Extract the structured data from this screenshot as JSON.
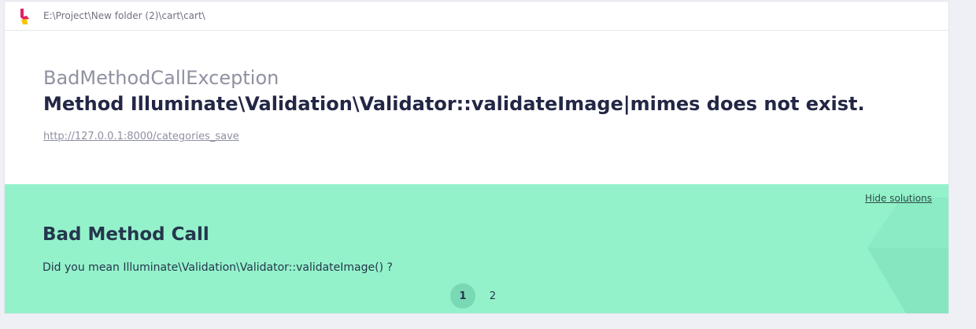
{
  "header": {
    "path": "E:\\Project\\New folder (2)\\cart\\cart\\",
    "logo_icon": "ignition-flame-icon"
  },
  "exception": {
    "class": "BadMethodCallException",
    "message": "Method Illuminate\\Validation\\Validator::validateImage|mimes does not exist.",
    "url": "http://127.0.0.1:8000/categories_save"
  },
  "solutions": {
    "hide_label": "Hide solutions",
    "title": "Bad Method Call",
    "description": "Did you mean Illuminate\\Validation\\Validator::validateImage() ?",
    "pages": [
      "1",
      "2"
    ],
    "active_page": "1"
  },
  "colors": {
    "background": "#eef0f5",
    "solutions_bg": "#94f2cb",
    "active_page_bg": "#7ad9b5",
    "title_text": "#232745",
    "muted_text": "#8f91a1",
    "logo_red": "#e3205f",
    "logo_yellow": "#f7c400"
  }
}
